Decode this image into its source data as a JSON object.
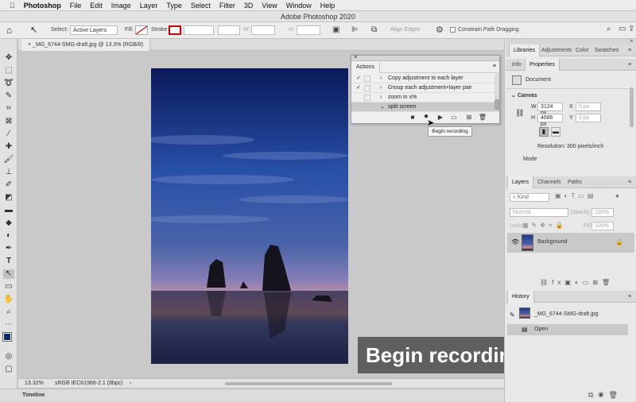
{
  "menubar": {
    "app": "Photoshop",
    "items": [
      "File",
      "Edit",
      "Image",
      "Layer",
      "Type",
      "Select",
      "Filter",
      "3D",
      "View",
      "Window",
      "Help"
    ]
  },
  "window_title": "Adobe Photoshop 2020",
  "options": {
    "select_label": "Select:",
    "select_value": "Active Layers",
    "fill_label": "Fill:",
    "stroke_label": "Stroke:",
    "w_label": "W:",
    "h_label": "H:",
    "align_edges": "Align Edges",
    "constrain": "Constrain Path Dragging"
  },
  "document": {
    "tab": "_MG_6744-SMG-draft.jpg @ 13.3% (RGB/8)",
    "zoom": "13.32%",
    "color_profile": "sRGB IEC61966-2.1 (8bpc)"
  },
  "timeline": "Timeline",
  "actions_panel": {
    "title": "Actions",
    "rows": [
      {
        "check": "✓",
        "caret": "›",
        "label": "Copy adjustment to each layer",
        "selected": false
      },
      {
        "check": "✓",
        "caret": "›",
        "label": "Group each adjustment+layer pair",
        "selected": false
      },
      {
        "check": "",
        "caret": "›",
        "label": "zoom in x%",
        "selected": false
      },
      {
        "check": "",
        "caret": "⌄",
        "label": "split screen",
        "selected": true
      }
    ]
  },
  "tooltip": "Begin recording",
  "caption": "Begin recording.",
  "right_tabs1": [
    "Libraries",
    "Adjustments",
    "Color",
    "Swatches"
  ],
  "right_tabs2": [
    "Info",
    "Properties"
  ],
  "properties": {
    "doc_label": "Document",
    "canvas": "Canvas",
    "w_label": "W",
    "w_value": "3124 px",
    "x_label": "X",
    "x_placeholder": "0 px",
    "h_label": "H",
    "h_value": "4686 px",
    "y_label": "Y",
    "y_placeholder": "0 px",
    "resolution": "Resolution: 300 pixels/inch",
    "mode": "Mode"
  },
  "layers_tabs": [
    "Layers",
    "Channels",
    "Paths"
  ],
  "layers": {
    "kind": "Kind",
    "blend": "Normal",
    "opacity_label": "Opacity:",
    "opacity_value": "100%",
    "lock_label": "Lock:",
    "fill_label": "Fill:",
    "fill_value": "100%",
    "layer_name": "Background"
  },
  "history": {
    "title": "History",
    "snapshot": "_MG_6744-SMG-draft.jpg",
    "step": "Open"
  }
}
